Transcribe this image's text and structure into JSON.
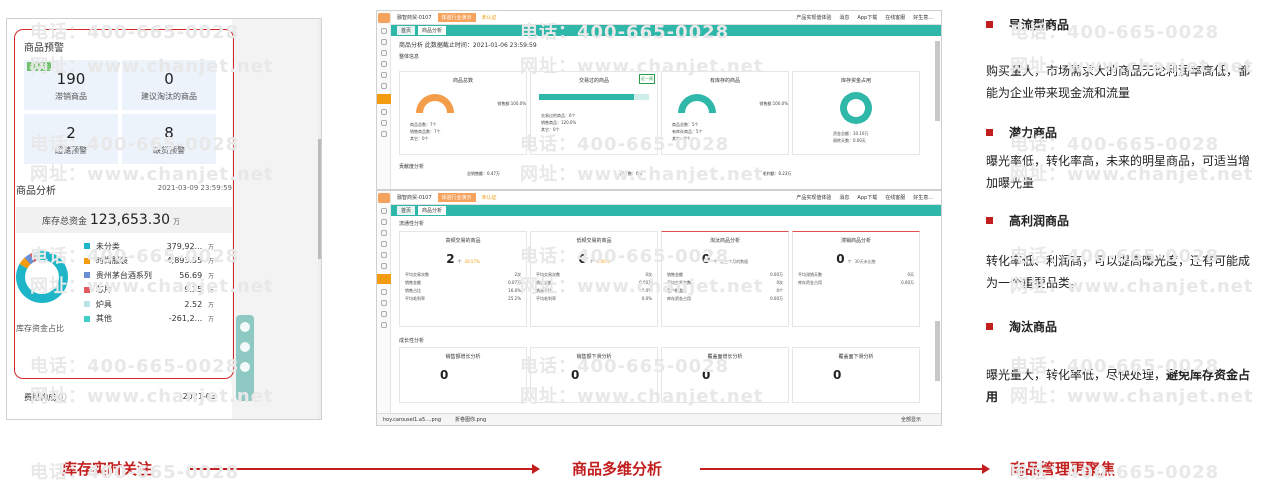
{
  "phone": {
    "warning_title": "商品预警",
    "tiles": [
      {
        "tag": "近60天",
        "value": "190",
        "label": "滞销商品"
      },
      {
        "tag": "",
        "value": "0",
        "label": "建议淘汰的商品"
      },
      {
        "tag": "",
        "value": "2",
        "label": "超储预警"
      },
      {
        "tag": "",
        "value": "8",
        "label": "缺货预警"
      }
    ],
    "analysis_title": "商品分析",
    "analysis_time": "2021-03-09 23:59:59",
    "capital_label": "库存总资金",
    "capital_value": "123,653.30",
    "capital_unit": "万",
    "donut_caption": "库存资金占比",
    "legend": [
      {
        "name": "未分类",
        "value": "379,92...",
        "unit": "万",
        "color": "#1eb5c8"
      },
      {
        "name": "时尚服装",
        "value": "4,893.55",
        "unit": "万",
        "color": "#f39c12"
      },
      {
        "name": "贵州茅台酒系列",
        "value": "56.69",
        "unit": "万",
        "color": "#6a8fd6"
      },
      {
        "name": "芯片",
        "value": "9.25",
        "unit": "万",
        "color": "#e2585c"
      },
      {
        "name": "炉具",
        "value": "2.52",
        "unit": "万",
        "color": "#b7e3e9"
      },
      {
        "name": "其他",
        "value": "-261,2...",
        "unit": "万",
        "color": "#3ed0c8"
      }
    ],
    "cost_label": "费用构成",
    "cost_date": "2021-03"
  },
  "screen1": {
    "app_title": "融智商贸-0107",
    "btn_trial": "体验行业演示",
    "btn_auth": "未认证",
    "top_links": [
      "产品实现值体验",
      "消息",
      "App下载",
      "在线客服",
      "好生意..."
    ],
    "tabs": [
      "首页",
      "商品分析"
    ],
    "breadcrumb": "商品分析  此数据截止时间：2021-01-06 23:59:59",
    "section": "整体信息",
    "cards": [
      {
        "title": "商品总数",
        "side": "销售额:100.0%",
        "rows": [
          [
            "商品总数：7个",
            ""
          ],
          [
            "销售商品数：7个",
            ""
          ],
          [
            "其它：0个",
            ""
          ]
        ]
      },
      {
        "title": "交易过的商品",
        "bar": "交易商品：85.7%",
        "rows": [
          [
            "交易过的商品：6个",
            ""
          ],
          [
            "销售商品：120.0%",
            ""
          ],
          [
            "其它：0个",
            ""
          ]
        ]
      },
      {
        "title": "有库存的商品",
        "side": "销售额:100.0%",
        "rows": [
          [
            "商品总数：5个",
            ""
          ],
          [
            "有库存商品：5个",
            ""
          ],
          [
            "其它：0个",
            ""
          ]
        ]
      },
      {
        "title": "库存资金占用",
        "rows": [
          [
            "资金总额：10.10万",
            ""
          ],
          [
            "周转天数：0.00天",
            ""
          ]
        ]
      }
    ],
    "section2": "贡献度分析",
    "contrib": [
      "总销售额：0.47万",
      "客户数：0家",
      "毛利额：0.23万"
    ],
    "flag": "近一周"
  },
  "screen2": {
    "app_title": "融智商贸-0107",
    "btn_trial": "体验行业演示",
    "btn_auth": "未认证",
    "tabs": [
      "首页",
      "商品分析"
    ],
    "section": "流通性分析",
    "cards": [
      {
        "title": "高频交易的商品",
        "num": "2",
        "unit": "个",
        "pct": "28.57%",
        "pct_color": "#f39c12",
        "rows": [
          [
            "平均交易次数",
            "2次"
          ],
          [
            "销售金额",
            "0.07万"
          ],
          [
            "销售占比",
            "16.0%"
          ],
          [
            "平均毛利率",
            "25.2%"
          ]
        ]
      },
      {
        "title": "低频交易的商品",
        "num": "0",
        "unit": "个",
        "pct": "0.00%",
        "pct_color": "#f39c12",
        "rows": [
          [
            "平均交易次数",
            "0次"
          ],
          [
            "销售金额",
            "0.00万"
          ],
          [
            "销售占比",
            "0.0%"
          ],
          [
            "平均毛利率",
            "0.0%"
          ]
        ]
      },
      {
        "title": "淘汰商品分析",
        "num": "0",
        "unit": "个",
        "pct": "近三个月的数据",
        "pct_color": "#666666",
        "rows": [
          [
            "销售金额",
            "0.00万"
          ],
          [
            "平均交易次数",
            "0次"
          ],
          [
            "客户覆盖数",
            "0个"
          ],
          [
            "库存资金占用",
            "0.00万"
          ]
        ]
      },
      {
        "title": "滞销商品分析",
        "num": "0",
        "unit": "个",
        "pct": "30天未出售",
        "pct_color": "#666666",
        "rows": [
          [
            "平均滞销天数",
            "0天"
          ],
          [
            "库存资金占用",
            "0.00万"
          ]
        ]
      }
    ],
    "section2": "成长性分析",
    "growth": [
      "销售额增长分析",
      "销售额下滑分析",
      "覆盖面增长分析",
      "覆盖面下滑分析"
    ],
    "growth_vals": [
      "0",
      "0",
      "0",
      "0"
    ],
    "downloads": [
      "hoy.carousel1.a5....png",
      "折卷图你.png"
    ],
    "show_all": "全部显示"
  },
  "right": {
    "h1": "导流型商品",
    "t1": "购买量大，市场需求大的商品无论利润率高低，都能为企业带来现金流和流量",
    "h2": "潜力商品",
    "t2": "曝光率低，转化率高，未来的明星商品，可适当增加曝光量",
    "h3": "高利润商品",
    "t3": "转化率低、利润高，可以提高曝光度，还有可能成为一个重要品类。",
    "h4": "淘汰商品",
    "t4a": "曝光量大，转化率低，尽快处理，",
    "t4b": "避免库存资金占用"
  },
  "flow": {
    "step1": "库存实时关注",
    "step2": "商品多维分析",
    "step3": "商品管理更聚焦"
  },
  "watermark": {
    "phone": "电话：400-665-0028",
    "web": "网址：www.chanjet.net"
  }
}
